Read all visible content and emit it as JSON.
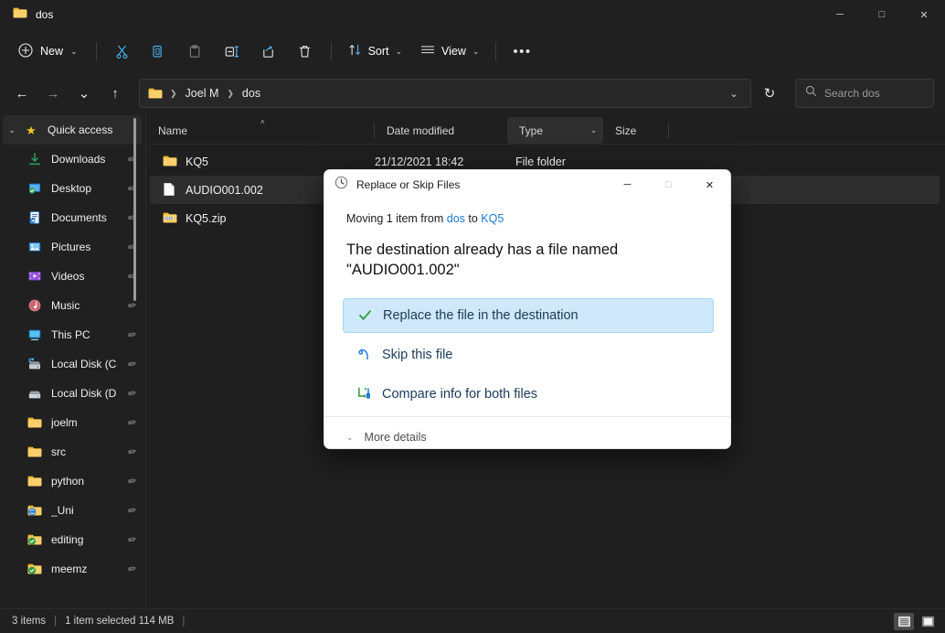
{
  "window": {
    "title": "dos",
    "folder_icon": "folder-icon",
    "controls": {
      "minimize": "─",
      "maximize": "□",
      "close": "✕"
    }
  },
  "toolbar": {
    "new_label": "New",
    "new_icon": "plus-circle-icon",
    "new_chevron": "⌄",
    "cut_icon": "✂",
    "copy_icon": "copy-icon",
    "paste_icon": "paste-icon",
    "rename_icon": "rename-icon",
    "share_icon": "share-icon",
    "delete_icon": "🗑",
    "sort_label": "Sort",
    "sort_icon": "↑↓",
    "sort_chevron": "⌄",
    "view_label": "View",
    "view_icon": "☰",
    "view_chevron": "⌄",
    "more_label": "•••"
  },
  "addressbar": {
    "back_icon": "←",
    "forward_icon": "→",
    "recent_icon": "⌄",
    "up_icon": "↑",
    "folder_icon": "folder-icon",
    "crumbs": [
      "Joel M",
      "dos"
    ],
    "crumb_sep": "❯",
    "dropdown_icon": "⌄",
    "refresh_icon": "↻"
  },
  "search": {
    "placeholder": "Search dos",
    "value": "",
    "icon": "🔍"
  },
  "sidebar": {
    "header": {
      "label": "Quick access",
      "icon": "★",
      "expander": "⌄"
    },
    "pin_icon": "📌",
    "items": [
      {
        "label": "Downloads",
        "icon": "⬇",
        "icon_kind": "download",
        "pinned": true
      },
      {
        "label": "Desktop",
        "icon": "🖥",
        "icon_kind": "desktop",
        "pinned": true
      },
      {
        "label": "Documents",
        "icon": "📄",
        "icon_kind": "documents",
        "pinned": true
      },
      {
        "label": "Pictures",
        "icon": "🖼",
        "icon_kind": "pictures",
        "pinned": true
      },
      {
        "label": "Videos",
        "icon": "🎬",
        "icon_kind": "videos",
        "pinned": true
      },
      {
        "label": "Music",
        "icon": "🎵",
        "icon_kind": "music",
        "pinned": true
      },
      {
        "label": "This PC",
        "icon": "💻",
        "icon_kind": "thispc",
        "pinned": true
      },
      {
        "label": "Local Disk (C",
        "icon": "💽",
        "icon_kind": "drive-c",
        "pinned": true
      },
      {
        "label": "Local Disk (D",
        "icon": "💽",
        "icon_kind": "drive-d",
        "pinned": true
      },
      {
        "label": "joelm",
        "icon": "📁",
        "icon_kind": "folder",
        "pinned": true
      },
      {
        "label": "src",
        "icon": "📁",
        "icon_kind": "folder",
        "pinned": true
      },
      {
        "label": "python",
        "icon": "📁",
        "icon_kind": "folder",
        "pinned": true
      },
      {
        "label": "_Uni",
        "icon": "📁",
        "icon_kind": "folder-sync",
        "pinned": true
      },
      {
        "label": "editing",
        "icon": "📁",
        "icon_kind": "folder-check",
        "pinned": true
      },
      {
        "label": "meemz",
        "icon": "📁",
        "icon_kind": "folder-check",
        "pinned": true
      }
    ]
  },
  "filelist": {
    "columns": [
      {
        "key": "name",
        "label": "Name",
        "sorted": true,
        "sort_caret": "˄"
      },
      {
        "key": "date",
        "label": "Date modified",
        "sorted": false
      },
      {
        "key": "type",
        "label": "Type",
        "sorted": false,
        "hovered": true,
        "chevron": "⌄"
      },
      {
        "key": "size",
        "label": "Size",
        "sorted": false
      }
    ],
    "rows": [
      {
        "name": "KQ5",
        "date": "21/12/2021 18:42",
        "type": "File folder",
        "size": "",
        "icon_kind": "folder",
        "selected": false
      },
      {
        "name": "AUDIO001.002",
        "date": "",
        "type": "",
        "size": "",
        "icon_kind": "file",
        "selected": true
      },
      {
        "name": "KQ5.zip",
        "date": "",
        "type": "",
        "size": "",
        "icon_kind": "archive",
        "selected": false
      }
    ]
  },
  "statusbar": {
    "item_count": "3 items",
    "selection": "1 item selected  114 MB",
    "pipe": "|",
    "view_details_icon": "details-view-icon",
    "view_tiles_icon": "large-icons-view-icon"
  },
  "dialog": {
    "title": "Replace or Skip Files",
    "title_icon": "clock-history-icon",
    "controls": {
      "minimize": "─",
      "maximize": "□",
      "close": "✕"
    },
    "subtitle_prefix": "Moving 1 item from ",
    "source": "dos",
    "subtitle_mid": " to ",
    "destination": "KQ5",
    "heading": "The destination already has a file named \"AUDIO001.002\"",
    "options": [
      {
        "label": "Replace the file in the destination",
        "icon": "check-icon",
        "glyph": "✓",
        "color": "#2d9a3e",
        "active": true
      },
      {
        "label": "Skip this file",
        "icon": "skip-icon",
        "glyph": "↷",
        "color": "#1e7ad4",
        "active": false
      },
      {
        "label": "Compare info for both files",
        "icon": "compare-icon",
        "glyph": "⇄",
        "color": "#3aa03a",
        "active": false
      }
    ],
    "more_details_label": "More details",
    "more_details_chevron": "⌄"
  },
  "colors": {
    "accent": "#1e7ad4",
    "window_bg": "#1f1f1f",
    "chrome_bg": "#202020",
    "dialog_bg": "#ffffff",
    "selection_highlight": "#cfe8fa",
    "folder_yellow": "#f5c14b",
    "green": "#2d9a3e"
  }
}
